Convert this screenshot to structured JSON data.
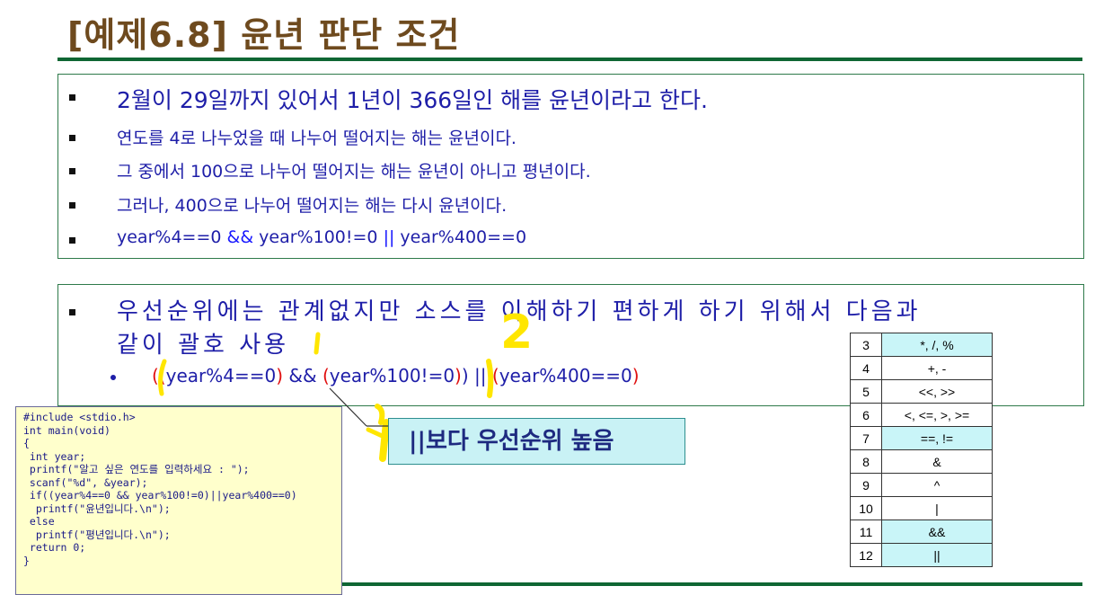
{
  "title": "[예제6.8] 윤년 판단 조건",
  "box1": {
    "lines": [
      "2월이 29일까지 있어서 1년이 366일인 해를 윤년이라고 한다.",
      "연도를 4로 나누었을 때 나누어 떨어지는 해는 윤년이다.",
      "그 중에서 100으로 나누어 떨어지는 해는 윤년이 아니고 평년이다.",
      "그러나, 400으로 나누어 떨어지는 해는 다시 윤년이다."
    ],
    "formula": {
      "a": "year%4==0 ",
      "op1": "&&",
      "b": " year%100!=0 ",
      "op2": "||",
      "c": " year%400==0"
    }
  },
  "box2": {
    "line1": "우선순위에는 관계없지만 소스를 이해하기 편하게 하기 위해서 다음과",
    "line2": "같이 괄호 사용",
    "expr": {
      "p1": "(",
      "p2": "(",
      "t1": "year%4==0",
      "p3": ")",
      "and": " && ",
      "p4": "(",
      "t2": "year%100!=0",
      "p5": ")",
      "p6": ")",
      "or": " || ",
      "p7": "(",
      "t3": "year%400==0",
      "p8": ")"
    }
  },
  "code_lines": [
    "#include <stdio.h>",
    "int main(void)",
    "{",
    " int year;",
    " printf(\"알고 싶은 연도를 입력하세요 : \");",
    " scanf(\"%d\", &year);",
    " if((year%4==0 && year%100!=0)||year%400==0)",
    "  printf(\"윤년입니다.\\n\");",
    " else",
    "  printf(\"평년입니다.\\n\");",
    " return 0;",
    "}"
  ],
  "callout": "||보다 우선순위 높음",
  "annotation": "2",
  "precedence": [
    {
      "level": "3",
      "ops": "*, /, %",
      "hl": true
    },
    {
      "level": "4",
      "ops": "+, -",
      "hl": false
    },
    {
      "level": "5",
      "ops": "<<, >>",
      "hl": false
    },
    {
      "level": "6",
      "ops": "<, <=, >, >=",
      "hl": false
    },
    {
      "level": "7",
      "ops": "==, !=",
      "hl": true
    },
    {
      "level": "8",
      "ops": "&",
      "hl": false
    },
    {
      "level": "9",
      "ops": "^",
      "hl": false
    },
    {
      "level": "10",
      "ops": "|",
      "hl": false
    },
    {
      "level": "11",
      "ops": "&&",
      "hl": true
    },
    {
      "level": "12",
      "ops": "||",
      "hl": true
    }
  ],
  "colors": {
    "title": "#6e4a1e",
    "body_text": "#1e1ea8",
    "paren": "#e01010",
    "highlight_cell": "#c9f5f8",
    "code_bg": "#ffffcc",
    "annotation": "#ffe600"
  }
}
